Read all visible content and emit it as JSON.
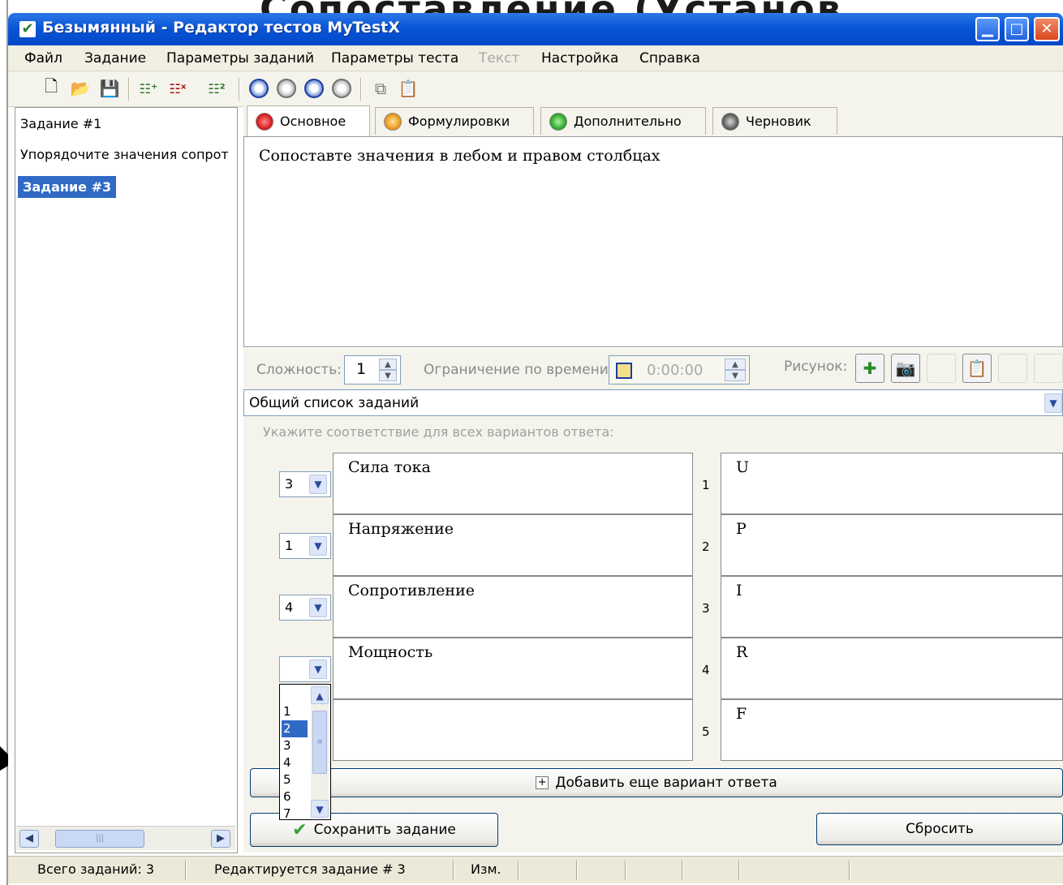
{
  "slide_heading": "Сопоставление (Установление)",
  "window": {
    "title": "Безымянный - Редактор тестов MyTestX",
    "minimize_icon": "minimize-icon",
    "maximize_icon": "maximize-icon",
    "close_icon": "close-icon"
  },
  "menu": {
    "items": [
      "Файл",
      "Задание",
      "Параметры заданий",
      "Параметры теста",
      "Текст",
      "Настройка",
      "Справка"
    ],
    "disabled": [
      "Текст"
    ]
  },
  "tree": {
    "items": [
      "Задание #1",
      "Упорядочите значения сопрот",
      "Задание #3"
    ],
    "selected": "Задание #3"
  },
  "tabs": [
    {
      "label": "Основное",
      "color": "#e02020",
      "active": true
    },
    {
      "label": "Формулировки",
      "color": "#f0a020",
      "active": false
    },
    {
      "label": "Дополнительно",
      "color": "#30b030",
      "active": false
    },
    {
      "label": "Черновик",
      "color": "#606060",
      "active": false
    }
  ],
  "editor": {
    "text": "Сопоставте значения в лебом и правом столбцах"
  },
  "params": {
    "difficulty_label": "Сложность:",
    "difficulty_value": "1",
    "time_limit_label": "Ограничение по времени:",
    "time_limit_value": "0:00:00",
    "picture_label": "Рисунок:"
  },
  "task_list": {
    "value": "Общий список заданий"
  },
  "answers": {
    "hint": "Укажите соответствие для всех вариантов ответа:",
    "rows": [
      {
        "select": "3",
        "left": "Сила тока",
        "num": "1",
        "right": "U"
      },
      {
        "select": "1",
        "left": "Напряжение",
        "num": "2",
        "right": "P"
      },
      {
        "select": "4",
        "left": "Сопротивление",
        "num": "3",
        "right": "I"
      },
      {
        "select": "",
        "left": "Мощность",
        "num": "4",
        "right": "R"
      },
      {
        "select": "",
        "left": "",
        "num": "5",
        "right": "F"
      }
    ],
    "dropdown_options": [
      "1",
      "2",
      "3",
      "4",
      "5",
      "6",
      "7"
    ],
    "dropdown_selected": "2",
    "add_button": "Добавить еще вариант ответа"
  },
  "buttons": {
    "save": "Сохранить задание",
    "reset": "Сбросить"
  },
  "status": {
    "total": "Всего заданий: 3",
    "editing": "Редактируется задание # 3",
    "modified": "Изм."
  }
}
